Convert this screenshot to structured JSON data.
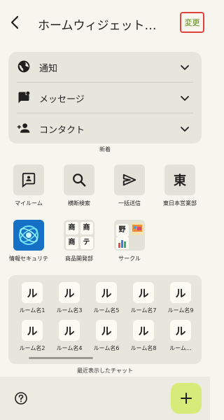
{
  "header": {
    "title": "ホームウィジェット…",
    "change_label": "変更"
  },
  "notify": {
    "items": [
      {
        "label": "通知",
        "icon": "globe-icon"
      },
      {
        "label": "メッセージ",
        "icon": "message-icon"
      },
      {
        "label": "コンタクト",
        "icon": "add-person-icon"
      }
    ],
    "caption": "新着"
  },
  "shortcuts": {
    "row1": [
      {
        "label": "マイルーム",
        "icon": "my-room-icon"
      },
      {
        "label": "横断検索",
        "icon": "search-icon"
      },
      {
        "label": "一括送信",
        "icon": "send-icon"
      },
      {
        "label": "東日本営業部",
        "icon_text": "東"
      }
    ],
    "row2": [
      {
        "label": "情報セキュリテ",
        "icon": "security-app-icon"
      },
      {
        "label": "商品開発部",
        "grid": [
          "商",
          "商",
          "商",
          "テ"
        ]
      },
      {
        "label": "サークル",
        "grid": [
          "野",
          "",
          "",
          ""
        ]
      }
    ]
  },
  "rooms": {
    "glyph": "ル",
    "top": [
      "ルーム名1",
      "ルーム名3",
      "ルーム名5",
      "ルーム名7",
      "ルーム名9"
    ],
    "bottom": [
      "ルーム名2",
      "ルーム名4",
      "ルーム名6",
      "ルーム名8",
      "ルーム…"
    ],
    "caption": "最近表示したチャット"
  },
  "colors": {
    "background": "#f7f6ee",
    "card": "#e7e6dc",
    "accent": "#d6eb79",
    "change_text": "#5b8a0b",
    "highlight_border": "#e2423c"
  }
}
